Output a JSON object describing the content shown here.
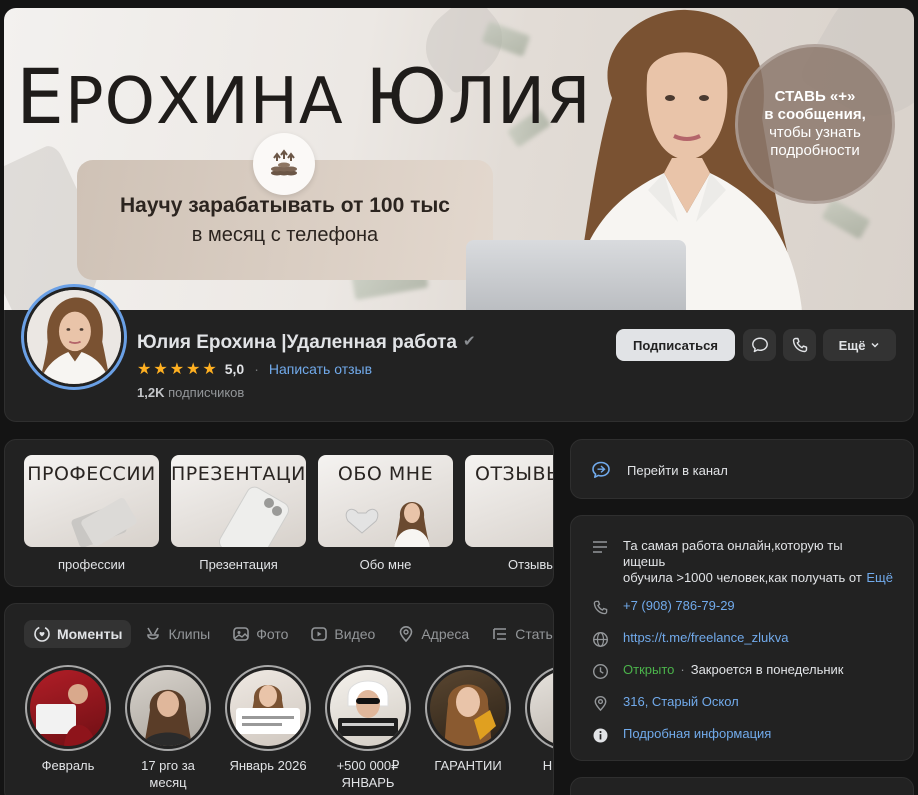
{
  "cover": {
    "title_first_letter": "Е",
    "title_rest_1": "РОХИНА ",
    "title_second_letter": "Ю",
    "title_rest_2": "ЛИЯ",
    "promo_line1": "Научу зарабатывать от 100 тыс",
    "promo_line2": "в месяц с телефона",
    "cta_line1": "СТАВЬ «+»",
    "cta_line2": "в сообщения,",
    "cta_line3": "чтобы узнать",
    "cta_line4": "подробности"
  },
  "profile": {
    "name": "Юлия Ерохина |Удаленная работа",
    "verified_icon": "check-icon",
    "rating": "5,0",
    "stars": 5,
    "review_link": "Написать отзыв",
    "subscribers_count": "1,2K",
    "subscribers_label": "подписчиков",
    "subscribe_button": "Подписаться",
    "more_button": "Ещё"
  },
  "menu": {
    "items": [
      {
        "thumb_title": "ПРОФЕССИИ",
        "label": "профессии"
      },
      {
        "thumb_title": "ПРЕЗЕНТАЦИЯ",
        "label": "Презентация"
      },
      {
        "thumb_title": "ОБО МНЕ",
        "label": "Обо мне"
      },
      {
        "thumb_title": "ОТЗЫВЫ",
        "label": "Отзывы"
      }
    ]
  },
  "tabs": {
    "items": [
      {
        "label": "Моменты",
        "icon": "moments-icon",
        "active": true
      },
      {
        "label": "Клипы",
        "icon": "clips-icon",
        "active": false
      },
      {
        "label": "Фото",
        "icon": "photo-icon",
        "active": false
      },
      {
        "label": "Видео",
        "icon": "video-icon",
        "active": false
      },
      {
        "label": "Адреса",
        "icon": "location-icon",
        "active": false
      },
      {
        "label": "Статьи",
        "icon": "articles-icon",
        "active": false
      }
    ]
  },
  "stories": {
    "items": [
      {
        "label": "Февраль"
      },
      {
        "label": "17 рго за месяц"
      },
      {
        "label": "Январь 2026"
      },
      {
        "label": "+500 000₽ ЯНВАРЬ"
      },
      {
        "label": "ГАРАНТИИ"
      },
      {
        "label": "Н... же..."
      }
    ]
  },
  "channel": {
    "label": "Перейти в канал"
  },
  "info": {
    "description_line1": "Та самая работа онлайн,которую ты",
    "description_line2": "ищешь",
    "description_line3": "обучила >1000 человек,как получать от",
    "description_more": "Ещё",
    "phone": "+7 (908) 786-79-29",
    "website": "https://t.me/freelance_zlukva",
    "status_open": "Открыто",
    "status_close": "Закроется в понедельник",
    "address": "316, Старый Оскол",
    "details_link": "Подробная информация"
  },
  "colors": {
    "background": "#141414",
    "card": "#222222",
    "link": "#71aaeb",
    "star": "#ffb021",
    "open_green": "#4bb34b",
    "avatar_ring": "#6aa0e6"
  }
}
